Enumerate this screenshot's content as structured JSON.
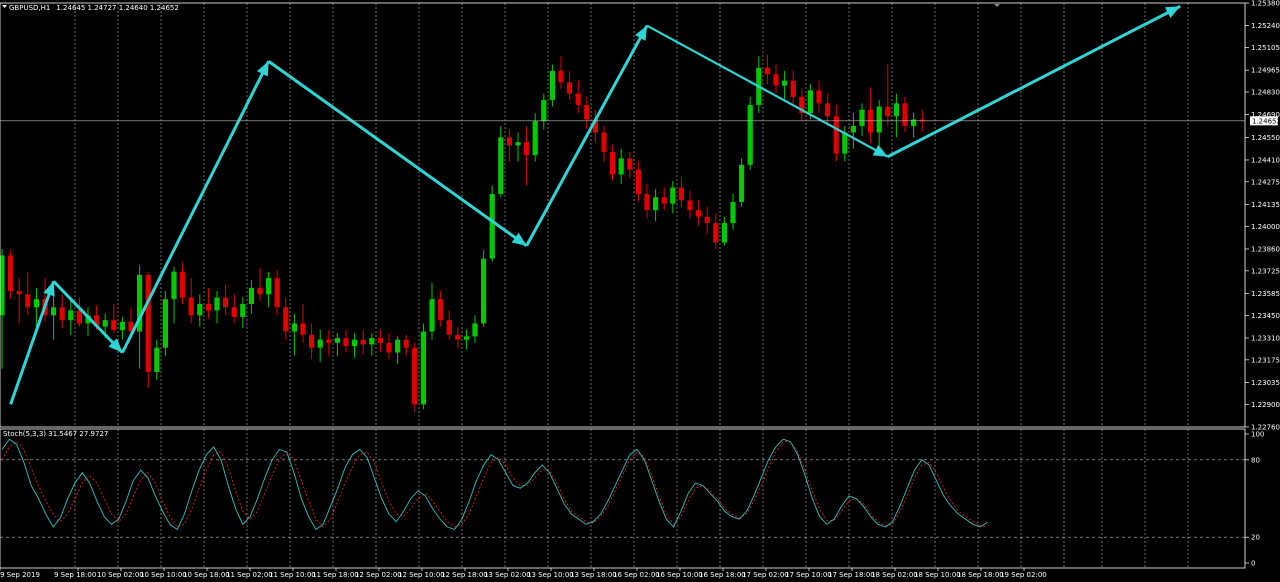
{
  "chart_data": [
    {
      "type": "candlestick",
      "header": {
        "symbol_timeframe": "GBPUSD,H1",
        "ohlc": "1.24645 1.24727 1.24640 1.24652"
      },
      "current_price": 1.24652,
      "current_price_label": "1.24652",
      "y_ticks": [
        "1.25380",
        "1.25240",
        "1.25105",
        "1.24965",
        "1.24830",
        "1.24690",
        "1.24550",
        "1.24410",
        "1.24275",
        "1.24135",
        "1.24000",
        "1.23860",
        "1.23725",
        "1.23585",
        "1.23450",
        "1.23310",
        "1.23175",
        "1.23035",
        "1.22900",
        "1.22760"
      ],
      "ylim": [
        1.2276,
        1.2538
      ],
      "x_ticks": [
        "9 Sep 2019",
        "9 Sep 18:00",
        "10 Sep 02:00",
        "10 Sep 10:00",
        "10 Sep 18:00",
        "11 Sep 02:00",
        "11 Sep 10:00",
        "11 Sep 18:00",
        "12 Sep 02:00",
        "12 Sep 10:00",
        "12 Sep 18:00",
        "13 Sep 02:00",
        "13 Sep 10:00",
        "13 Sep 18:00",
        "16 Sep 02:00",
        "16 Sep 10:00",
        "16 Sep 18:00",
        "17 Sep 02:00",
        "17 Sep 10:00",
        "17 Sep 18:00",
        "18 Sep 02:00",
        "18 Sep 10:00",
        "18 Sep 18:00",
        "19 Sep 02:00"
      ],
      "grid": true,
      "colors": {
        "bull": "#00c800",
        "bear": "#e00000",
        "grid": "#bbbbbb",
        "arrow": "#2fd5d5",
        "axis": "#ffffff"
      },
      "candles": [
        [
          1.2345,
          1.2386,
          1.2312,
          1.2382
        ],
        [
          1.2382,
          1.2385,
          1.2355,
          1.236
        ],
        [
          1.236,
          1.2368,
          1.234,
          1.2358
        ],
        [
          1.2358,
          1.2372,
          1.2345,
          1.235
        ],
        [
          1.235,
          1.2362,
          1.2338,
          1.2355
        ],
        [
          1.2355,
          1.2368,
          1.2341,
          1.2345
        ],
        [
          1.2345,
          1.236,
          1.233,
          1.235
        ],
        [
          1.235,
          1.2358,
          1.2337,
          1.2342
        ],
        [
          1.2342,
          1.2355,
          1.2333,
          1.2348
        ],
        [
          1.2348,
          1.2356,
          1.2338,
          1.234
        ],
        [
          1.234,
          1.235,
          1.2332,
          1.2345
        ],
        [
          1.2345,
          1.2351,
          1.2336,
          1.2338
        ],
        [
          1.2338,
          1.2346,
          1.2331,
          1.2342
        ],
        [
          1.2342,
          1.2352,
          1.2334,
          1.2336
        ],
        [
          1.2336,
          1.2344,
          1.233,
          1.2341
        ],
        [
          1.2341,
          1.235,
          1.2333,
          1.2335
        ],
        [
          1.2335,
          1.2376,
          1.2312,
          1.237
        ],
        [
          1.237,
          1.2372,
          1.23,
          1.231
        ],
        [
          1.231,
          1.233,
          1.2305,
          1.2325
        ],
        [
          1.2325,
          1.236,
          1.232,
          1.2355
        ],
        [
          1.2355,
          1.2375,
          1.234,
          1.2372
        ],
        [
          1.2372,
          1.2378,
          1.2352,
          1.2356
        ],
        [
          1.2356,
          1.2368,
          1.234,
          1.2345
        ],
        [
          1.2345,
          1.2358,
          1.2338,
          1.2352
        ],
        [
          1.2352,
          1.2362,
          1.2343,
          1.2348
        ],
        [
          1.2348,
          1.236,
          1.234,
          1.2356
        ],
        [
          1.2356,
          1.2364,
          1.2345,
          1.235
        ],
        [
          1.235,
          1.2358,
          1.234,
          1.2344
        ],
        [
          1.2344,
          1.2356,
          1.2337,
          1.2352
        ],
        [
          1.2352,
          1.2367,
          1.2346,
          1.2362
        ],
        [
          1.2362,
          1.2374,
          1.2354,
          1.2358
        ],
        [
          1.2358,
          1.2372,
          1.235,
          1.2368
        ],
        [
          1.2368,
          1.2373,
          1.2345,
          1.235
        ],
        [
          1.235,
          1.2356,
          1.233,
          1.2335
        ],
        [
          1.2335,
          1.2346,
          1.232,
          1.234
        ],
        [
          1.234,
          1.2352,
          1.2328,
          1.2333
        ],
        [
          1.2333,
          1.234,
          1.2318,
          1.2325
        ],
        [
          1.2325,
          1.2336,
          1.2316,
          1.233
        ],
        [
          1.233,
          1.2336,
          1.232,
          1.2328
        ],
        [
          1.2328,
          1.2334,
          1.232,
          1.2331
        ],
        [
          1.2331,
          1.2336,
          1.2322,
          1.2326
        ],
        [
          1.2326,
          1.2334,
          1.2319,
          1.233
        ],
        [
          1.233,
          1.2336,
          1.2321,
          1.2327
        ],
        [
          1.2327,
          1.2334,
          1.232,
          1.2331
        ],
        [
          1.2331,
          1.2336,
          1.2322,
          1.2328
        ],
        [
          1.2328,
          1.2334,
          1.2318,
          1.2322
        ],
        [
          1.2322,
          1.2332,
          1.2315,
          1.233
        ],
        [
          1.233,
          1.2333,
          1.232,
          1.2325
        ],
        [
          1.2325,
          1.2328,
          1.2285,
          1.229
        ],
        [
          1.229,
          1.234,
          1.2287,
          1.2335
        ],
        [
          1.2335,
          1.2365,
          1.233,
          1.2355
        ],
        [
          1.2355,
          1.236,
          1.2338,
          1.2342
        ],
        [
          1.2342,
          1.2348,
          1.233,
          1.2333
        ],
        [
          1.2333,
          1.2338,
          1.2325,
          1.233
        ],
        [
          1.233,
          1.2336,
          1.2324,
          1.2332
        ],
        [
          1.2332,
          1.2345,
          1.2328,
          1.234
        ],
        [
          1.234,
          1.2385,
          1.2338,
          1.238
        ],
        [
          1.238,
          1.2425,
          1.2378,
          1.242
        ],
        [
          1.242,
          1.2462,
          1.2418,
          1.2455
        ],
        [
          1.2455,
          1.246,
          1.244,
          1.245
        ],
        [
          1.245,
          1.2458,
          1.244,
          1.2452
        ],
        [
          1.2452,
          1.2462,
          1.2425,
          1.2444
        ],
        [
          1.2444,
          1.247,
          1.244,
          1.2465
        ],
        [
          1.2465,
          1.2482,
          1.246,
          1.2478
        ],
        [
          1.2478,
          1.25,
          1.2474,
          1.2496
        ],
        [
          1.2496,
          1.2505,
          1.2485,
          1.2489
        ],
        [
          1.2489,
          1.2496,
          1.2478,
          1.2482
        ],
        [
          1.2482,
          1.249,
          1.247,
          1.2475
        ],
        [
          1.2475,
          1.248,
          1.246,
          1.2466
        ],
        [
          1.2466,
          1.2472,
          1.2452,
          1.2458
        ],
        [
          1.2458,
          1.2462,
          1.244,
          1.2446
        ],
        [
          1.2446,
          1.245,
          1.2428,
          1.2432
        ],
        [
          1.2432,
          1.2448,
          1.2426,
          1.2442
        ],
        [
          1.2442,
          1.2446,
          1.243,
          1.2435
        ],
        [
          1.2435,
          1.244,
          1.2415,
          1.242
        ],
        [
          1.242,
          1.2426,
          1.2405,
          1.241
        ],
        [
          1.241,
          1.2423,
          1.2403,
          1.2418
        ],
        [
          1.2418,
          1.2424,
          1.241,
          1.2414
        ],
        [
          1.2414,
          1.2428,
          1.2408,
          1.2424
        ],
        [
          1.2424,
          1.243,
          1.2412,
          1.2416
        ],
        [
          1.2416,
          1.2422,
          1.2405,
          1.241
        ],
        [
          1.241,
          1.2416,
          1.24,
          1.2406
        ],
        [
          1.2406,
          1.2412,
          1.2395,
          1.2402
        ],
        [
          1.2402,
          1.2408,
          1.2386,
          1.239
        ],
        [
          1.239,
          1.2406,
          1.2388,
          1.2402
        ],
        [
          1.2402,
          1.242,
          1.2398,
          1.2415
        ],
        [
          1.2415,
          1.2442,
          1.2412,
          1.2438
        ],
        [
          1.2438,
          1.248,
          1.2435,
          1.2475
        ],
        [
          1.2475,
          1.2505,
          1.247,
          1.2498
        ],
        [
          1.2498,
          1.2506,
          1.2488,
          1.2494
        ],
        [
          1.2494,
          1.25,
          1.2482,
          1.2487
        ],
        [
          1.2487,
          1.2496,
          1.2478,
          1.249
        ],
        [
          1.249,
          1.2496,
          1.2475,
          1.248
        ],
        [
          1.248,
          1.2485,
          1.2465,
          1.247
        ],
        [
          1.247,
          1.2488,
          1.2466,
          1.2484
        ],
        [
          1.2484,
          1.249,
          1.247,
          1.2476
        ],
        [
          1.2476,
          1.2482,
          1.2462,
          1.2468
        ],
        [
          1.2468,
          1.2475,
          1.244,
          1.2445
        ],
        [
          1.2445,
          1.2462,
          1.244,
          1.2458
        ],
        [
          1.2458,
          1.247,
          1.2448,
          1.2462
        ],
        [
          1.2462,
          1.2476,
          1.2456,
          1.2472
        ],
        [
          1.2472,
          1.2486,
          1.2452,
          1.2458
        ],
        [
          1.2458,
          1.2478,
          1.245,
          1.2474
        ],
        [
          1.2474,
          1.25,
          1.2462,
          1.2468
        ],
        [
          1.2468,
          1.2482,
          1.2455,
          1.2476
        ],
        [
          1.2476,
          1.248,
          1.2458,
          1.2462
        ],
        [
          1.2462,
          1.247,
          1.2455,
          1.2466
        ],
        [
          1.2466,
          1.2472,
          1.2458,
          1.2465
        ]
      ],
      "arrows": [
        [
          1,
          1.229,
          6,
          1.2366
        ],
        [
          6,
          1.2366,
          14,
          1.2322
        ],
        [
          14,
          1.2322,
          31,
          1.2502
        ],
        [
          31,
          1.2502,
          61,
          1.2388
        ],
        [
          61,
          1.2388,
          75,
          1.2524
        ],
        [
          75,
          1.2524,
          103,
          1.2443
        ],
        [
          103,
          1.2443,
          137,
          1.2536
        ]
      ]
    },
    {
      "type": "line",
      "header": "Stoch(5,3,3) 31.5467 27.9727",
      "y_ticks": [
        "100",
        "80",
        "20",
        "0"
      ],
      "levels": [
        80,
        20
      ],
      "ylim": [
        0,
        100
      ],
      "series_main": [
        88,
        96,
        92,
        78,
        60,
        50,
        38,
        28,
        35,
        50,
        62,
        70,
        62,
        48,
        36,
        30,
        34,
        48,
        64,
        72,
        66,
        52,
        40,
        30,
        26,
        38,
        56,
        72,
        84,
        90,
        80,
        60,
        42,
        30,
        36,
        50,
        66,
        80,
        88,
        86,
        70,
        50,
        36,
        26,
        30,
        44,
        58,
        74,
        84,
        88,
        82,
        66,
        50,
        38,
        32,
        40,
        50,
        56,
        52,
        42,
        34,
        28,
        26,
        34,
        48,
        64,
        76,
        84,
        80,
        70,
        60,
        58,
        62,
        70,
        76,
        70,
        58,
        46,
        38,
        34,
        30,
        32,
        38,
        48,
        60,
        72,
        84,
        88,
        80,
        64,
        48,
        34,
        28,
        40,
        54,
        62,
        60,
        54,
        48,
        40,
        36,
        34,
        40,
        52,
        66,
        80,
        90,
        96,
        94,
        84,
        68,
        50,
        36,
        30,
        34,
        44,
        52,
        50,
        44,
        36,
        30,
        28,
        32,
        44,
        58,
        72,
        80,
        76,
        64,
        52,
        44,
        38,
        34,
        30,
        28,
        31.5
      ],
      "series_signal": [
        80,
        90,
        94,
        88,
        74,
        60,
        48,
        38,
        32,
        38,
        50,
        62,
        68,
        62,
        50,
        38,
        32,
        38,
        52,
        64,
        70,
        62,
        48,
        36,
        28,
        30,
        42,
        58,
        72,
        84,
        86,
        74,
        56,
        40,
        34,
        40,
        54,
        68,
        80,
        86,
        80,
        64,
        48,
        34,
        28,
        34,
        48,
        62,
        74,
        84,
        86,
        78,
        62,
        48,
        38,
        36,
        42,
        50,
        54,
        48,
        40,
        32,
        28,
        30,
        38,
        52,
        66,
        78,
        82,
        76,
        66,
        60,
        60,
        66,
        72,
        72,
        62,
        50,
        40,
        36,
        32,
        31,
        36,
        44,
        56,
        68,
        80,
        86,
        82,
        68,
        52,
        38,
        30,
        36,
        48,
        58,
        60,
        56,
        50,
        42,
        38,
        35,
        38,
        48,
        60,
        74,
        86,
        94,
        94,
        86,
        72,
        56,
        42,
        33,
        33,
        40,
        48,
        50,
        46,
        38,
        32,
        29,
        30,
        40,
        52,
        66,
        76,
        78,
        70,
        58,
        48,
        40,
        36,
        32,
        29,
        28
      ]
    }
  ]
}
